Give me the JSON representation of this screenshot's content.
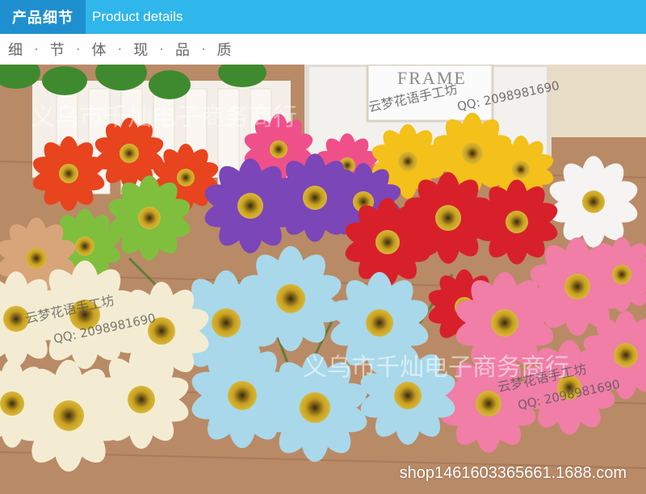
{
  "header": {
    "title_cn": "产品细节",
    "title_en": "Product details"
  },
  "subtitle": {
    "chars": [
      "细",
      "节",
      "体",
      "现",
      "品",
      "质"
    ],
    "separator": "·"
  },
  "photo": {
    "frame_text": "FRAME",
    "watermark_main": "义乌市千灿电子商务商行",
    "watermark_studio": "云梦花语手工坊",
    "watermark_qq": "QQ: 2098981690",
    "shop_url": "shop1461603365661.1688.com"
  },
  "colors": {
    "header_blue": "#2fb6ea",
    "header_dark_blue": "#1f90cf"
  }
}
